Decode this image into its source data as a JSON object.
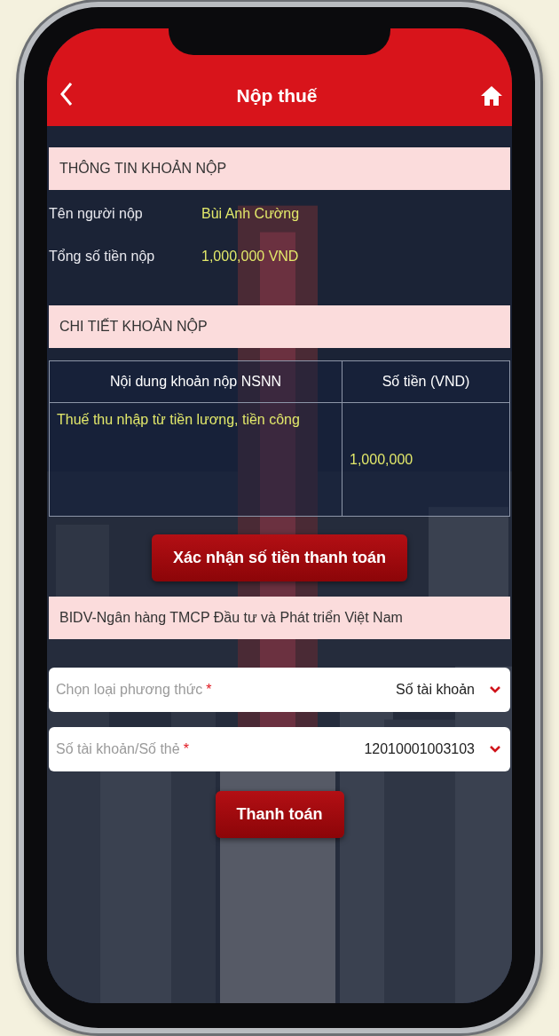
{
  "header": {
    "title": "Nộp thuế"
  },
  "payment_info": {
    "heading": "THÔNG TIN KHOẢN NỘP",
    "rows": [
      {
        "label": "Tên người nộp",
        "value": "Bùi Anh Cường"
      },
      {
        "label": "Tổng số tiền nộp",
        "value": "1,000,000 VND"
      }
    ]
  },
  "payment_details": {
    "heading": "CHI TIẾT KHOẢN NỘP",
    "table": {
      "columns": [
        "Nội dung khoản nộp NSNN",
        "Số tiền (VND)"
      ],
      "rows": [
        [
          "Thuế thu nhập từ tiền lương, tiền công",
          "1,000,000"
        ]
      ]
    }
  },
  "confirm_button": "Xác nhận số tiền thanh toán",
  "bank": "BIDV-Ngân hàng TMCP Đầu tư và Phát triển Việt Nam",
  "fields": [
    {
      "label": "Chọn loại phương thức",
      "mark": "*",
      "value": "Số tài khoản"
    },
    {
      "label": "Số tài khoản/Số thẻ",
      "mark": "*",
      "value": "12010001003103"
    }
  ],
  "pay_button": "Thanh toán"
}
